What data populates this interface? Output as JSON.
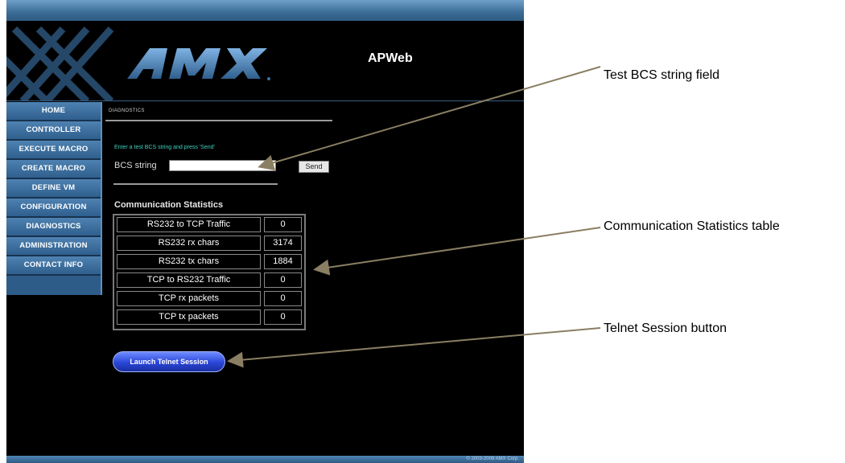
{
  "app": {
    "title": "APWeb",
    "logo_text": "AMX"
  },
  "sidebar": {
    "items": [
      {
        "label": "HOME"
      },
      {
        "label": "CONTROLLER"
      },
      {
        "label": "EXECUTE MACRO"
      },
      {
        "label": "CREATE MACRO"
      },
      {
        "label": "DEFINE VM"
      },
      {
        "label": "CONFIGURATION"
      },
      {
        "label": "DIAGNOSTICS"
      },
      {
        "label": "ADMINISTRATION"
      },
      {
        "label": "CONTACT INFO"
      }
    ]
  },
  "main": {
    "breadcrumb": "DIAGNOSTICS",
    "prompt": "Enter a test BCS string and press 'Send'",
    "bcs": {
      "label": "BCS string",
      "value": "",
      "send_label": "Send"
    },
    "stats": {
      "heading": "Communication Statistics",
      "rows": [
        {
          "label": "RS232 to TCP Traffic",
          "value": "0"
        },
        {
          "label": "RS232 rx chars",
          "value": "3174"
        },
        {
          "label": "RS232 tx chars",
          "value": "1884"
        },
        {
          "label": "TCP to RS232 Traffic",
          "value": "0"
        },
        {
          "label": "TCP rx packets",
          "value": "0"
        },
        {
          "label": "TCP tx packets",
          "value": "0"
        }
      ]
    },
    "telnet_label": "Launch Telnet Session"
  },
  "footer": {
    "copyright": "© 2003-2008 AMX Corp."
  },
  "annotations": {
    "bcs_field": "Test BCS string field",
    "stats_table": "Communication Statistics table",
    "telnet_button": "Telnet Session button"
  },
  "colors": {
    "nav_blue": "#2f5f8d",
    "prompt_teal": "#3fd0c0",
    "telnet_blue": "#2a46d8",
    "annotation_line": "#8a7f63"
  }
}
